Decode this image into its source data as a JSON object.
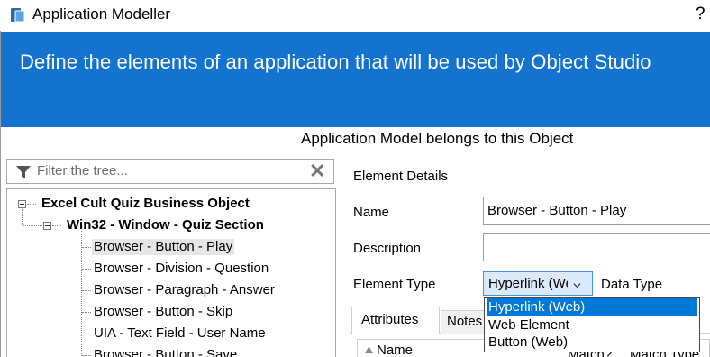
{
  "window": {
    "title": "Application Modeller",
    "help": "?"
  },
  "banner": {
    "text": "Define the elements of an application that will be used by Object Studio"
  },
  "model_label": "Application Model belongs to this Object",
  "filter": {
    "placeholder": "Filter the tree..."
  },
  "tree": {
    "root": "Excel Cult Quiz Business Object",
    "window": "Win32 - Window - Quiz Section",
    "items": [
      "Browser - Button - Play",
      "Browser - Division - Question",
      "Browser - Paragraph - Answer",
      "Browser - Button - Skip",
      "UIA - Text Field - User Name",
      "Browser - Button - Save"
    ]
  },
  "details": {
    "heading": "Element Details",
    "name_label": "Name",
    "name_value": "Browser - Button - Play",
    "description_label": "Description",
    "description_value": "",
    "element_type_label": "Element Type",
    "element_type_value": "Hyperlink (Web)",
    "data_type_label": "Data Type",
    "dropdown_options": [
      "Hyperlink (Web)",
      "Web Element",
      "Button (Web)"
    ]
  },
  "tabs": {
    "attributes": "Attributes",
    "notes": "Notes"
  },
  "table": {
    "name_header": "Name",
    "match_header": "Match?",
    "match_type_header": "Match Type"
  },
  "colors": {
    "banner": "#1473cf",
    "selection": "#0078d7"
  }
}
